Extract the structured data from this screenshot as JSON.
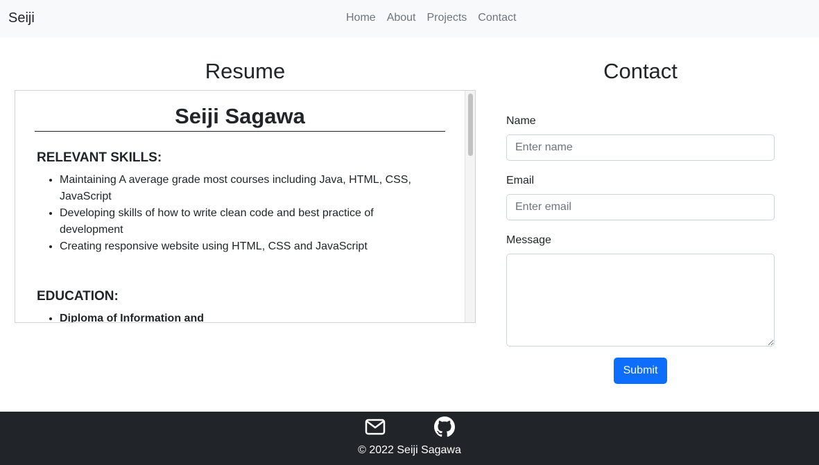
{
  "navbar": {
    "brand": "Seiji",
    "links": [
      "Home",
      "About",
      "Projects",
      "Contact"
    ]
  },
  "resume": {
    "heading": "Resume",
    "name": "Seiji Sagawa",
    "skills_title": "RELEVANT SKILLS:",
    "skills": [
      "Maintaining A average grade most courses including Java, HTML, CSS, JavaScript",
      "Developing skills of how to write clean code and best practice of development",
      "Creating responsive website using HTML, CSS and JavaScript"
    ],
    "education_title": "EDUCATION:",
    "education": [
      "Diploma of Information and"
    ]
  },
  "contact": {
    "heading": "Contact",
    "name_label": "Name",
    "name_placeholder": "Enter name",
    "email_label": "Email",
    "email_placeholder": "Enter email",
    "message_label": "Message",
    "submit_label": "Submit"
  },
  "footer": {
    "icons": [
      "mail-icon",
      "github-icon"
    ],
    "copyright": "© 2022 Seiji Sagawa"
  },
  "colors": {
    "navbar_bg": "#f8f9fa",
    "primary": "#0d6efd",
    "footer_bg": "#212529"
  }
}
